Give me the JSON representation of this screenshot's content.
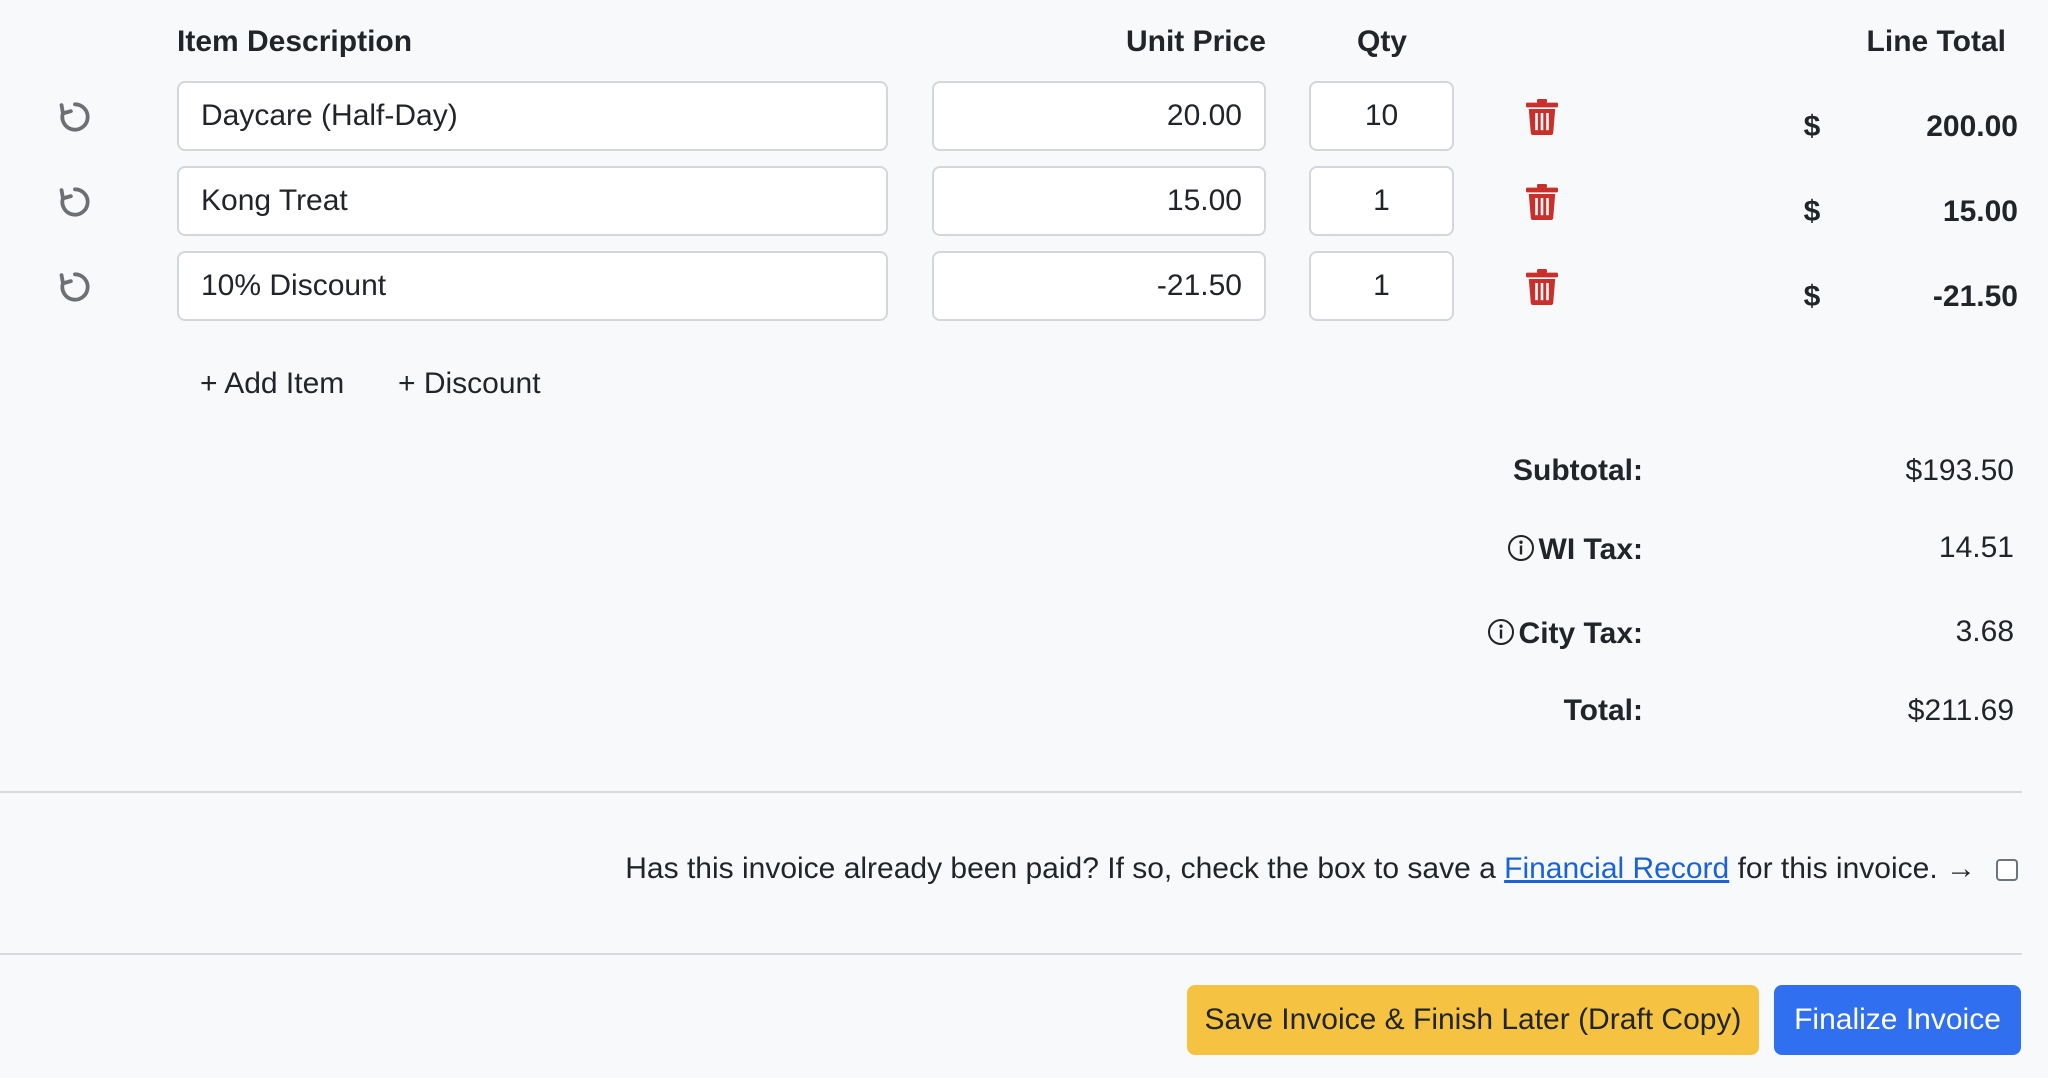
{
  "columns": {
    "description": "Item Description",
    "unit_price": "Unit Price",
    "qty": "Qty",
    "line_total": "Line Total"
  },
  "items": [
    {
      "description": "Daycare (Half-Day)",
      "unit_price": "20.00",
      "qty": "10",
      "currency": "$",
      "line_total": "200.00"
    },
    {
      "description": "Kong Treat",
      "unit_price": "15.00",
      "qty": "1",
      "currency": "$",
      "line_total": "15.00"
    },
    {
      "description": "10% Discount",
      "unit_price": "-21.50",
      "qty": "1",
      "currency": "$",
      "line_total": "-21.50"
    }
  ],
  "actions": {
    "add_item": "+ Add Item",
    "add_discount": "+ Discount"
  },
  "summary": {
    "subtotal_label": "Subtotal:",
    "subtotal_value": "$193.50",
    "wi_tax_label": "WI Tax:",
    "wi_tax_value": "14.51",
    "city_tax_label": "City Tax:",
    "city_tax_value": "3.68",
    "total_label": "Total:",
    "total_value": "$211.69"
  },
  "paid": {
    "text_before": "Has this invoice already been paid? If so, check the box to save a ",
    "link_text": "Financial Record",
    "text_after": " for this invoice. →",
    "checked": false
  },
  "buttons": {
    "draft": "Save Invoice & Finish Later (Draft Copy)",
    "finalize": "Finalize Invoice"
  },
  "colors": {
    "trash": "#c9302c",
    "draft_button": "#f5c242",
    "finalize_button": "#2f6ff0",
    "link": "#1a63d6"
  },
  "icons": [
    "reset-icon",
    "trash-icon",
    "info-icon"
  ]
}
